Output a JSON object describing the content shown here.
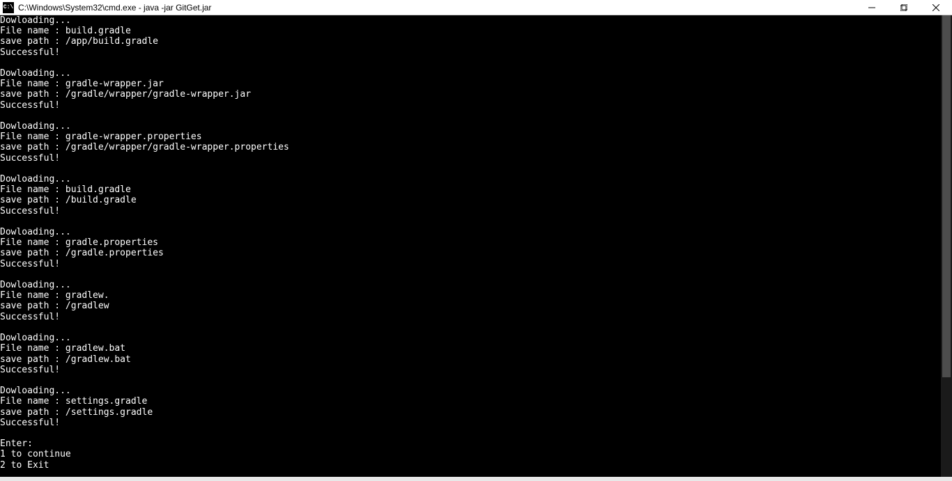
{
  "titlebar": {
    "icon_text": "C:\\",
    "title": "C:\\Windows\\System32\\cmd.exe - java  -jar GitGet.jar"
  },
  "terminal": {
    "lines": [
      "Dowloading...",
      "File name : build.gradle",
      "save path : /app/build.gradle",
      "Successful!",
      "",
      "Dowloading...",
      "File name : gradle-wrapper.jar",
      "save path : /gradle/wrapper/gradle-wrapper.jar",
      "Successful!",
      "",
      "Dowloading...",
      "File name : gradle-wrapper.properties",
      "save path : /gradle/wrapper/gradle-wrapper.properties",
      "Successful!",
      "",
      "Dowloading...",
      "File name : build.gradle",
      "save path : /build.gradle",
      "Successful!",
      "",
      "Dowloading...",
      "File name : gradle.properties",
      "save path : /gradle.properties",
      "Successful!",
      "",
      "Dowloading...",
      "File name : gradlew.",
      "save path : /gradlew",
      "Successful!",
      "",
      "Dowloading...",
      "File name : gradlew.bat",
      "save path : /gradlew.bat",
      "Successful!",
      "",
      "Dowloading...",
      "File name : settings.gradle",
      "save path : /settings.gradle",
      "Successful!",
      "",
      "Enter:",
      "1 to continue",
      "2 to Exit"
    ]
  }
}
